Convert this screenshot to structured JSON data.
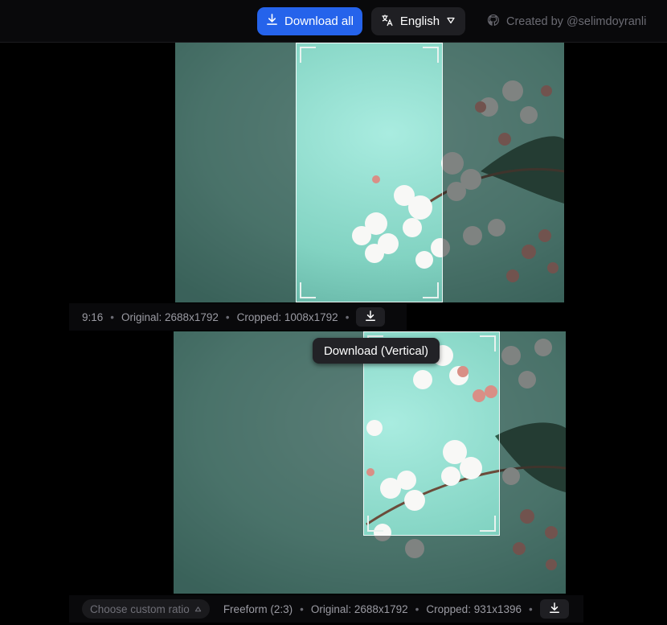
{
  "header": {
    "download_all_label": "Download all",
    "language_label": "English",
    "credit_label": "Created by @selimdoyranli"
  },
  "panel1": {
    "ratio": "9:16",
    "original": "Original: 2688x1792",
    "cropped": "Cropped: 1008x1792"
  },
  "tooltip": {
    "text": "Download (Vertical)"
  },
  "panel2": {
    "custom_ratio_label": "Choose custom ratio",
    "ratio": "Freeform (2:3)",
    "original": "Original: 2688x1792",
    "cropped": "Cropped: 931x1396"
  },
  "icons": [
    "download-icon",
    "translate-icon",
    "chevron-down-icon",
    "github-icon",
    "caret-up-icon"
  ],
  "colors": {
    "primary": "#2563eb",
    "background": "#000000",
    "photo_teal": "#8fd9c8"
  }
}
